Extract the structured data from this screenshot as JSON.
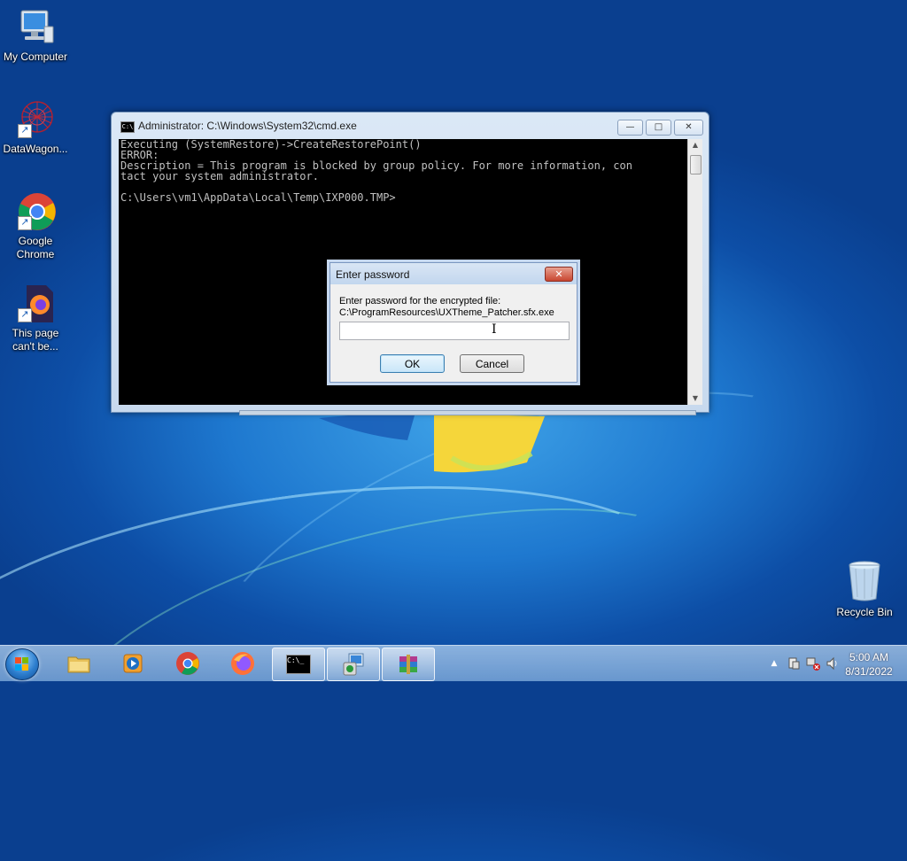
{
  "desktop": {
    "icons": [
      {
        "label": "My Computer",
        "icon": "computer-icon"
      },
      {
        "label": "DataWagon...",
        "icon": "datawagon-icon"
      },
      {
        "label": "Google Chrome",
        "icon": "chrome-icon"
      },
      {
        "label": "This page can't be...",
        "icon": "firefox-file-icon"
      }
    ],
    "recycle_bin": {
      "label": "Recycle Bin",
      "icon": "recycle-bin-icon"
    }
  },
  "cmd_window": {
    "title": "Administrator: C:\\Windows\\System32\\cmd.exe",
    "title_icon": "C:\\",
    "minimize": "—",
    "maximize": "□",
    "close": "✕",
    "console_text": "Executing (SystemRestore)->CreateRestorePoint()\nERROR:\nDescription = This program is blocked by group policy. For more information, con\ntact your system administrator.\n\nC:\\Users\\vm1\\AppData\\Local\\Temp\\IXP000.TMP>"
  },
  "password_dialog": {
    "title": "Enter password",
    "close": "✕",
    "prompt_line1": "Enter password for the encrypted file:",
    "prompt_line2": "C:\\ProgramResources\\UXTheme_Patcher.sfx.exe",
    "password_value": "",
    "ok_label": "OK",
    "cancel_label": "Cancel",
    "cursor": "I"
  },
  "taskbar": {
    "items": [
      {
        "name": "file-explorer",
        "icon": "folder-icon"
      },
      {
        "name": "media-player",
        "icon": "media-player-icon"
      },
      {
        "name": "chrome",
        "icon": "chrome-icon"
      },
      {
        "name": "firefox",
        "icon": "firefox-icon"
      },
      {
        "name": "cmd",
        "icon": "cmd-icon",
        "cmd_glyph": "C:\\_"
      },
      {
        "name": "installer",
        "icon": "installer-icon"
      },
      {
        "name": "winrar",
        "icon": "winrar-icon"
      }
    ],
    "tray": {
      "show_hidden": "▲",
      "time": "5:00 AM",
      "date": "8/31/2022"
    }
  },
  "colors": {
    "console_bg": "#000000",
    "console_text": "#c0c0c0",
    "dialog_close": "#c84630"
  }
}
